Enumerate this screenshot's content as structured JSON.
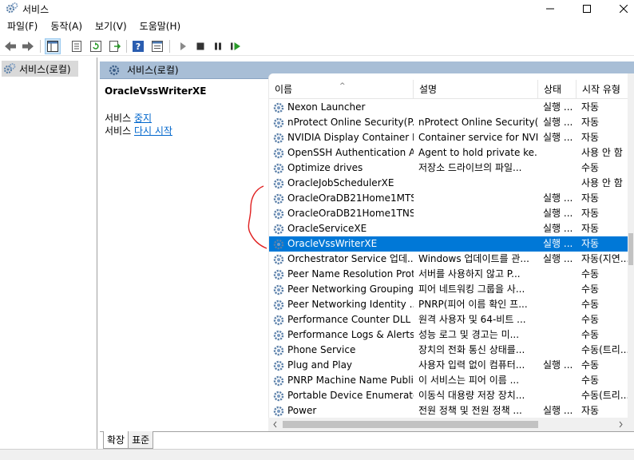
{
  "window": {
    "title": "서비스"
  },
  "menu": [
    "파일(F)",
    "동작(A)",
    "보기(V)",
    "도움말(H)"
  ],
  "tree": {
    "root_label": "서비스(로컬)"
  },
  "pane_header": {
    "title": "서비스(로컬)"
  },
  "detail": {
    "service_name": "OracleVssWriterXE",
    "stop_prefix": "서비스 ",
    "stop_link": "중지",
    "restart_prefix": "서비스 ",
    "restart_link": "다시 시작"
  },
  "columns": {
    "name": "이름",
    "description": "설명",
    "status": "상태",
    "startup": "시작 유형"
  },
  "services": [
    {
      "name": "Nexon Launcher",
      "description": "",
      "status": "실행 ...",
      "startup": "자동",
      "selected": false
    },
    {
      "name": "nProtect Online Security(P...",
      "description": "nProtect Online Security(...",
      "status": "실행 ...",
      "startup": "자동",
      "selected": false
    },
    {
      "name": "NVIDIA Display Container LS",
      "description": "Container service for NVI...",
      "status": "실행 ...",
      "startup": "자동",
      "selected": false
    },
    {
      "name": "OpenSSH Authentication A...",
      "description": "Agent to hold private ke...",
      "status": "",
      "startup": "사용 안 함",
      "selected": false
    },
    {
      "name": "Optimize drives",
      "description": "저장소 드라이브의 파일...",
      "status": "",
      "startup": "수동",
      "selected": false
    },
    {
      "name": "OracleJobSchedulerXE",
      "description": "",
      "status": "",
      "startup": "사용 안 함",
      "selected": false
    },
    {
      "name": "OracleOraDB21Home1MTS...",
      "description": "",
      "status": "실행 ...",
      "startup": "자동",
      "selected": false
    },
    {
      "name": "OracleOraDB21Home1TNS...",
      "description": "",
      "status": "실행 ...",
      "startup": "자동",
      "selected": false
    },
    {
      "name": "OracleServiceXE",
      "description": "",
      "status": "실행 ...",
      "startup": "자동",
      "selected": false
    },
    {
      "name": "OracleVssWriterXE",
      "description": "",
      "status": "실행 ...",
      "startup": "자동",
      "selected": true
    },
    {
      "name": "Orchestrator Service 업데...",
      "description": "Windows 업데이트를 관...",
      "status": "실행 ...",
      "startup": "자동(지연...",
      "selected": false
    },
    {
      "name": "Peer Name Resolution Prot...",
      "description": "서버를 사용하지 않고 P...",
      "status": "",
      "startup": "수동",
      "selected": false
    },
    {
      "name": "Peer Networking Grouping",
      "description": "피어 네트워킹 그룹을 사...",
      "status": "",
      "startup": "수동",
      "selected": false
    },
    {
      "name": "Peer Networking Identity ...",
      "description": "PNRP(피어 이름 확인 프...",
      "status": "",
      "startup": "수동",
      "selected": false
    },
    {
      "name": "Performance Counter DLL ...",
      "description": "원격 사용자 및 64-비트 ...",
      "status": "",
      "startup": "수동",
      "selected": false
    },
    {
      "name": "Performance Logs & Alerts",
      "description": "성능 로그 및 경고는 미...",
      "status": "",
      "startup": "수동",
      "selected": false
    },
    {
      "name": "Phone Service",
      "description": "장치의 전화 통신 상태를...",
      "status": "",
      "startup": "수동(트리...",
      "selected": false
    },
    {
      "name": "Plug and Play",
      "description": "사용자 입력 없이 컴퓨터...",
      "status": "실행 ...",
      "startup": "수동",
      "selected": false
    },
    {
      "name": "PNRP Machine Name Publi...",
      "description": "이 서비스는 피어 이름 ...",
      "status": "",
      "startup": "수동",
      "selected": false
    },
    {
      "name": "Portable Device Enumerato...",
      "description": "이동식 대용량 저장 장치...",
      "status": "",
      "startup": "수동(트리...",
      "selected": false
    },
    {
      "name": "Power",
      "description": "전원 정책 및 전원 정책 ...",
      "status": "실행 ...",
      "startup": "자동",
      "selected": false
    }
  ],
  "tabs": [
    "확장",
    "표준"
  ],
  "colors": {
    "selection": "#0078d7",
    "header": "#a8bed6",
    "annotation": "#e02020",
    "link": "#0066cc"
  },
  "icons": [
    "services-app-icon",
    "back-icon",
    "forward-icon",
    "console-tree-icon",
    "properties-icon",
    "refresh-icon",
    "export-icon",
    "help-icon",
    "view-icon",
    "play-icon",
    "stop-icon",
    "pause-icon",
    "resume-icon",
    "gear-icon"
  ]
}
